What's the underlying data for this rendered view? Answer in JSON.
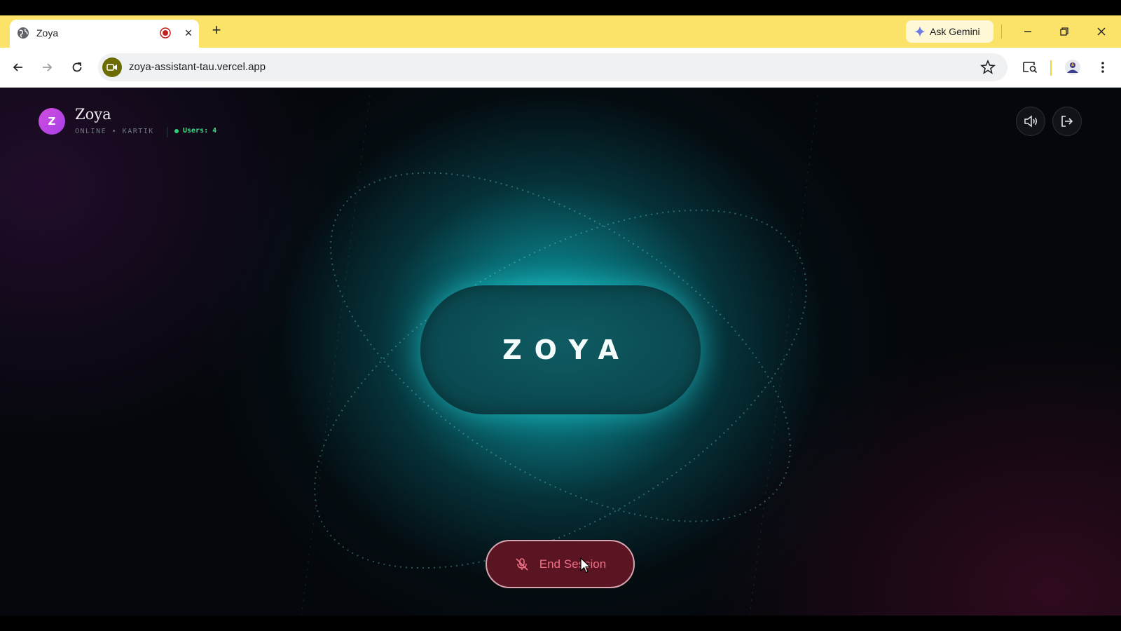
{
  "browser": {
    "tab": {
      "title": "Zoya",
      "favicon": "globe-icon",
      "close": "×"
    },
    "new_tab": "+",
    "ask_gemini": "Ask Gemini",
    "url": "zoya-assistant-tau.vercel.app"
  },
  "app": {
    "avatar_letter": "Z",
    "name": "Zoya",
    "status": "ONLINE • KARTIK",
    "users": "Users: 4",
    "center_label": "ZOYA",
    "end_session": "End Session",
    "icons": {
      "sound": "speaker-icon",
      "logout": "logout-icon",
      "mic": "mic-off-icon"
    }
  },
  "colors": {
    "accent_cyan": "#18d2d7",
    "brand_purple": "#c14be3",
    "online_green": "#3ee08a",
    "end_button_text": "#f06f85",
    "end_button_bg": "#5a1422",
    "chrome_tab_strip": "#fbe36a"
  }
}
